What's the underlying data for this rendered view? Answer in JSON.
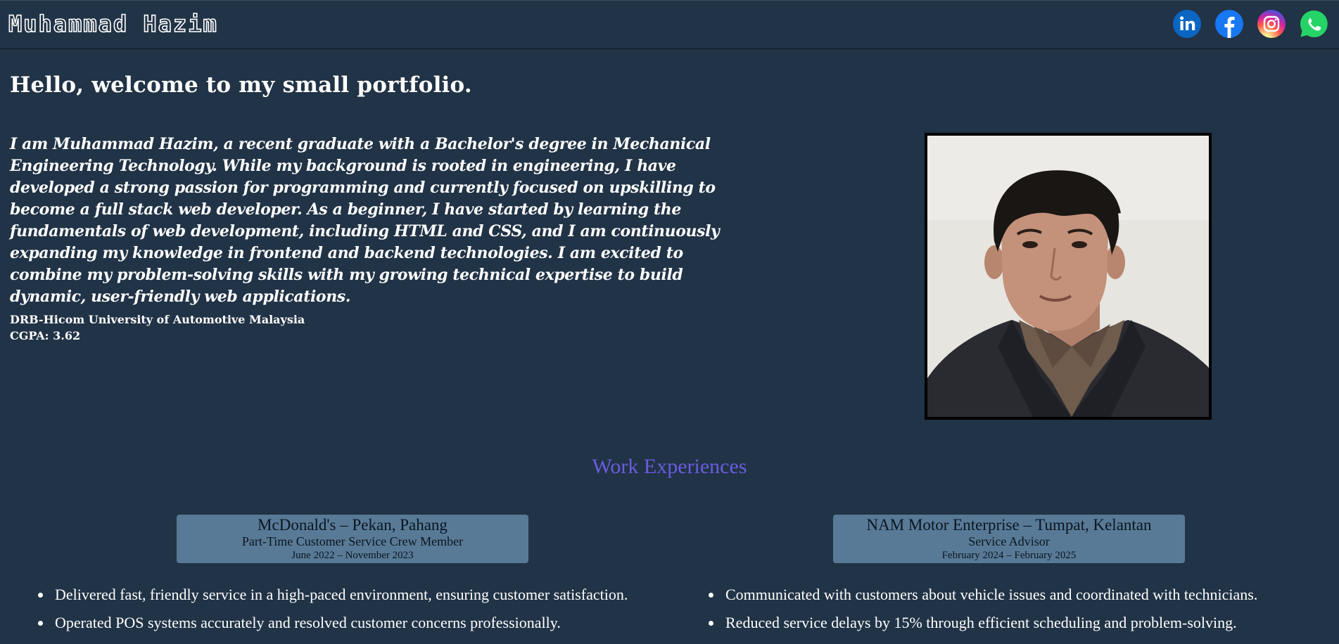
{
  "header": {
    "brand": "Muhammad Hazim",
    "social": [
      {
        "icon": "linkedin-icon",
        "color": "#0a66c2"
      },
      {
        "icon": "facebook-icon",
        "color": "#1877f2"
      },
      {
        "icon": "instagram-icon",
        "color": "#d6249f"
      },
      {
        "icon": "whatsapp-icon",
        "color": "#25d366"
      }
    ]
  },
  "hero": {
    "greeting": "Hello, welcome to my small portfolio.",
    "intro": "I am Muhammad Hazim, a recent graduate with a Bachelor's degree in Mechanical Engineering Technology. While my background is rooted in engineering, I have developed a strong passion for programming and currently focused on upskilling to become a full stack web developer. As a beginner, I have started by learning the fundamentals of web development, including HTML and CSS, and I am continuously expanding my knowledge in frontend and backend technologies. I am excited to combine my problem-solving skills with my growing technical expertise to build dynamic, user-friendly web applications.",
    "university": "DRB-Hicom University of Automotive Malaysia",
    "cgpa": "CGPA: 3.62"
  },
  "work": {
    "title": "Work Experiences",
    "jobs": [
      {
        "company": "McDonald's – Pekan, Pahang",
        "role": "Part-Time Customer Service Crew Member",
        "dates": "June 2022 – November 2023",
        "duties": [
          "Delivered fast, friendly service in a high-paced environment, ensuring customer satisfaction.",
          "Operated POS systems accurately and resolved customer concerns professionally."
        ]
      },
      {
        "company": "NAM Motor Enterprise – Tumpat, Kelantan",
        "role": "Service Advisor",
        "dates": "February 2024 – February 2025",
        "duties": [
          "Communicated with customers about vehicle issues and coordinated with technicians.",
          "Reduced service delays by 15% through efficient scheduling and problem-solving."
        ]
      }
    ]
  },
  "colors": {
    "background": "#213346",
    "accent_heading": "#6a5ce0",
    "card": "#587a96"
  }
}
